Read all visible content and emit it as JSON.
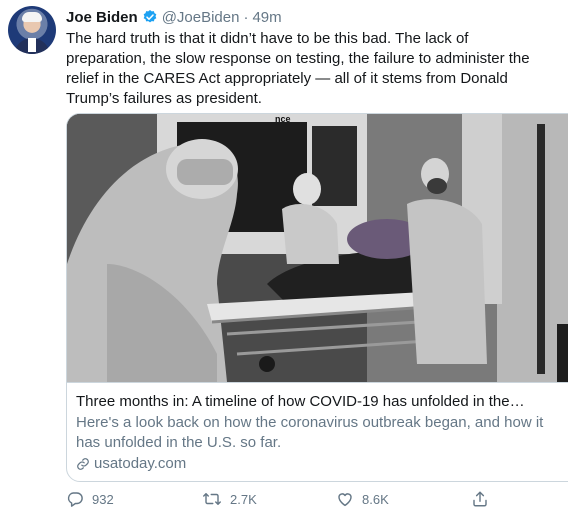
{
  "author": {
    "name": "Joe Biden",
    "handle": "@JoeBiden",
    "separator": "·",
    "time": "49m",
    "verified_icon": "verified-badge-icon",
    "accent_color": "#1da1f2"
  },
  "tweet": {
    "text": "The hard truth is that it didn’t have to be this bad. The lack of\npreparation, the slow response on testing, the failure to administer the\nrelief in the CARES Act appropriately — all of it stems from Donald\nTrump’s failures as president."
  },
  "card": {
    "image_icon": "ambulance-photo",
    "image_sign_text": "nce",
    "title": "Three months in: A timeline of how COVID-19 has unfolded in the…",
    "description": "Here's a look back on how the coronavirus outbreak began, and how it has unfolded in the U.S. so far.",
    "domain": "usatoday.com",
    "link_icon": "link-icon"
  },
  "actions": {
    "reply": {
      "icon": "reply-icon",
      "count": "932"
    },
    "retweet": {
      "icon": "retweet-icon",
      "count": "2.7K"
    },
    "like": {
      "icon": "heart-icon",
      "count": "8.6K"
    },
    "share": {
      "icon": "share-icon"
    }
  },
  "colors": {
    "text": "#14171a",
    "secondary": "#657786",
    "border": "#ccd6dd"
  }
}
